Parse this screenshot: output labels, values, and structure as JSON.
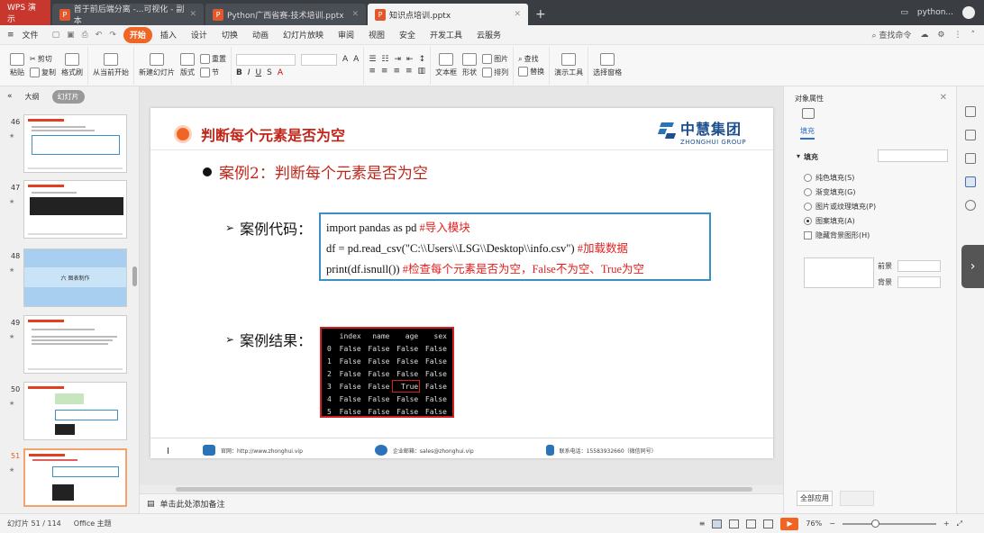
{
  "tabs": {
    "app": "WPS 演示",
    "docs": [
      {
        "label": "首于前后端分离 -...可视化 - 副本",
        "active": false
      },
      {
        "label": "Python广西省赛-技术培训.pptx",
        "active": false
      },
      {
        "label": "知识点培训.pptx",
        "active": true
      }
    ],
    "plus": "+",
    "user": "python..."
  },
  "menu": {
    "file": "文件",
    "items": [
      "开始",
      "插入",
      "设计",
      "切换",
      "动画",
      "幻灯片放映",
      "审阅",
      "视图",
      "安全",
      "开发工具",
      "云服务"
    ],
    "active": "开始",
    "search": "查找命令"
  },
  "ribbon": {
    "cut": "剪切",
    "paste": "粘贴",
    "copy": "复制",
    "format_painter": "格式刷",
    "from_current": "从当前开始",
    "new_slide": "新建幻灯片",
    "layout": "版式",
    "reset": "重置",
    "section": "节",
    "bold": "B",
    "italic": "I",
    "underline": "U",
    "textbox": "文本框",
    "shape": "形状",
    "picture": "图片",
    "arrange": "排列",
    "find": "查找",
    "replace": "替换",
    "presenter_tools": "演示工具",
    "select_pane": "选择窗格"
  },
  "left_panel": {
    "tab_outline": "大纲",
    "tab_slides": "幻灯片",
    "thumbs": [
      {
        "num": "46",
        "current": false
      },
      {
        "num": "47",
        "current": false
      },
      {
        "num": "48",
        "current": false,
        "caption": "六 图表制作"
      },
      {
        "num": "49",
        "current": false
      },
      {
        "num": "50",
        "current": false
      },
      {
        "num": "51",
        "current": true
      }
    ]
  },
  "slide": {
    "title": "判断每个元素是否为空",
    "logo_cn": "中慧集团",
    "logo_en": "ZHONGHUI GROUP",
    "bullet": "案例2：判断每个元素是否为空",
    "code_label": "案例代码：",
    "code_lines": [
      {
        "code": "import pandas as pd ",
        "comment": "#导入模块"
      },
      {
        "code": "df = pd.read_csv(\"C:\\\\Users\\\\LSG\\\\Desktop\\\\info.csv\") ",
        "comment": "#加载数据"
      },
      {
        "code": "print(df.isnull()) ",
        "comment": "#检查每个元素是否为空，False不为空、True为空"
      }
    ],
    "result_label": "案例结果：",
    "result_headers": [
      "",
      "index",
      "name",
      "age",
      "sex"
    ],
    "result_rows": [
      [
        "0",
        "False",
        "False",
        "False",
        "False"
      ],
      [
        "1",
        "False",
        "False",
        "False",
        "False"
      ],
      [
        "2",
        "False",
        "False",
        "False",
        "False"
      ],
      [
        "3",
        "False",
        "False",
        "True",
        "False"
      ],
      [
        "4",
        "False",
        "False",
        "False",
        "False"
      ],
      [
        "5",
        "False",
        "False",
        "False",
        "False"
      ]
    ],
    "footer_web": "官网：http://www.zhonghui.vip",
    "footer_mail": "企业邮箱：sales@zhonghui.vip",
    "footer_phone": "联系电话：15583932660（微信同号）"
  },
  "notes_placeholder": "单击此处添加备注",
  "right_panel": {
    "title": "对象属性",
    "tab_fill": "填充",
    "section": "填充",
    "options": [
      {
        "label": "纯色填充(S)",
        "type": "radio",
        "on": false
      },
      {
        "label": "渐变填充(G)",
        "type": "radio",
        "on": false
      },
      {
        "label": "图片或纹理填充(P)",
        "type": "radio",
        "on": false
      },
      {
        "label": "图案填充(A)",
        "type": "radio",
        "on": true
      },
      {
        "label": "隐藏背景图形(H)",
        "type": "check",
        "on": false
      }
    ],
    "foreground": "前景",
    "background": "背景",
    "apply_all": "全部应用"
  },
  "status": {
    "slide_info": "幻灯片 51 / 114",
    "theme": "Office 主题",
    "zoom": "76%",
    "minus": "−",
    "plus": "+"
  }
}
